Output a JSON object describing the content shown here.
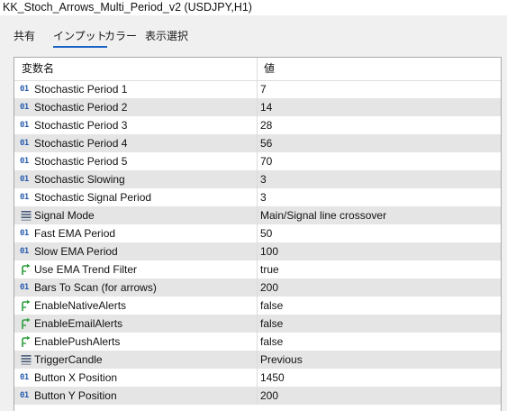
{
  "window": {
    "title": "KK_Stoch_Arrows_Multi_Period_v2 (USDJPY,H1)"
  },
  "tabs": [
    {
      "label": "共有",
      "active": false
    },
    {
      "label": "インプット",
      "active": true
    },
    {
      "label": "カラー",
      "active": false
    },
    {
      "label": "表示選択",
      "active": false
    }
  ],
  "table": {
    "header": {
      "name": "変数名",
      "value": "値"
    },
    "rows": [
      {
        "icon": "integer-icon",
        "icon_text": "01",
        "name": "Stochastic Period 1",
        "value": "7"
      },
      {
        "icon": "integer-icon",
        "icon_text": "01",
        "name": "Stochastic Period 2",
        "value": "14"
      },
      {
        "icon": "integer-icon",
        "icon_text": "01",
        "name": "Stochastic Period 3",
        "value": "28"
      },
      {
        "icon": "integer-icon",
        "icon_text": "01",
        "name": "Stochastic Period 4",
        "value": "56"
      },
      {
        "icon": "integer-icon",
        "icon_text": "01",
        "name": "Stochastic Period 5",
        "value": "70"
      },
      {
        "icon": "integer-icon",
        "icon_text": "01",
        "name": "Stochastic Slowing",
        "value": "3"
      },
      {
        "icon": "integer-icon",
        "icon_text": "01",
        "name": "Stochastic Signal Period",
        "value": "3"
      },
      {
        "icon": "enum-icon",
        "name": "Signal Mode",
        "value": "Main/Signal line crossover"
      },
      {
        "icon": "integer-icon",
        "icon_text": "01",
        "name": "Fast EMA Period",
        "value": "50"
      },
      {
        "icon": "integer-icon",
        "icon_text": "01",
        "name": "Slow EMA Period",
        "value": "100"
      },
      {
        "icon": "boolean-icon",
        "name": "Use EMA Trend Filter",
        "value": "true"
      },
      {
        "icon": "integer-icon",
        "icon_text": "01",
        "name": "Bars To Scan (for arrows)",
        "value": "200"
      },
      {
        "icon": "boolean-icon",
        "name": "EnableNativeAlerts",
        "value": "false"
      },
      {
        "icon": "boolean-icon",
        "name": "EnableEmailAlerts",
        "value": "false"
      },
      {
        "icon": "boolean-icon",
        "name": "EnablePushAlerts",
        "value": "false"
      },
      {
        "icon": "enum-icon",
        "name": "TriggerCandle",
        "value": "Previous"
      },
      {
        "icon": "integer-icon",
        "icon_text": "01",
        "name": "Button X Position",
        "value": "1450"
      },
      {
        "icon": "integer-icon",
        "icon_text": "01",
        "name": "Button Y Position",
        "value": "200"
      }
    ]
  },
  "colors": {
    "accent": "#1a64c8",
    "integer_icon": "#2a5db0",
    "boolean_icon": "#2e9e3e",
    "enum_icon": "#4a5a7a",
    "row_alt": "#e5e5e5",
    "panel_bg": "#f0f0f0"
  }
}
